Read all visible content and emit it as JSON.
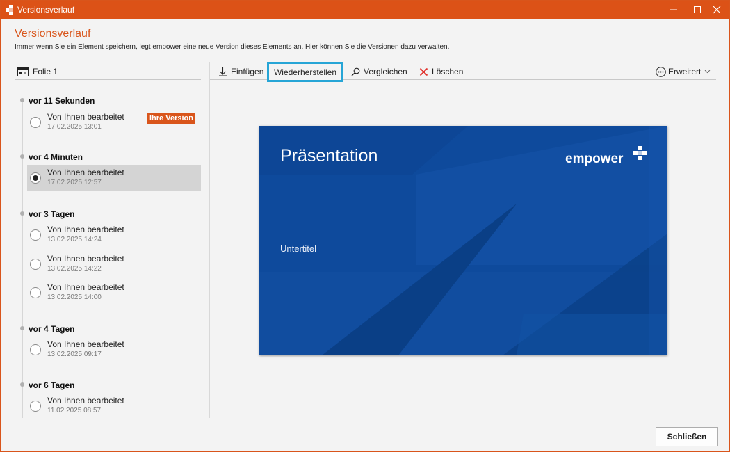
{
  "window": {
    "title": "Versionsverlauf",
    "accent_color": "#dc5217"
  },
  "header": {
    "title": "Versionsverlauf",
    "subtitle": "Immer wenn Sie ein Element speichern, legt empower eine neue Version dieses Elements an. Hier können Sie die Versionen dazu verwalten."
  },
  "left_panel": {
    "element_label": "Folie 1",
    "element_icon": "slide-icon"
  },
  "toolbar": {
    "insert_label": "Einfügen",
    "restore_label": "Wiederherstellen",
    "compare_label": "Vergleichen",
    "delete_label": "Löschen",
    "more_label": "Erweitert",
    "highlight_color": "#26a5d6"
  },
  "history": [
    {
      "label": "vor 11 Sekunden",
      "items": [
        {
          "who": "Von Ihnen bearbeitet",
          "when": "17.02.2025 13:01",
          "badge": "Ihre Version",
          "selected": false
        }
      ]
    },
    {
      "label": "vor 4 Minuten",
      "items": [
        {
          "who": "Von Ihnen bearbeitet",
          "when": "17.02.2025 12:57",
          "selected": true
        }
      ]
    },
    {
      "label": "vor 3 Tagen",
      "items": [
        {
          "who": "Von Ihnen bearbeitet",
          "when": "13.02.2025 14:24",
          "selected": false
        },
        {
          "who": "Von Ihnen bearbeitet",
          "when": "13.02.2025 14:22",
          "selected": false
        },
        {
          "who": "Von Ihnen bearbeitet",
          "when": "13.02.2025 14:00",
          "selected": false
        }
      ]
    },
    {
      "label": "vor 4 Tagen",
      "items": [
        {
          "who": "Von Ihnen bearbeitet",
          "when": "13.02.2025 09:17",
          "selected": false
        }
      ]
    },
    {
      "label": "vor 6 Tagen",
      "items": [
        {
          "who": "Von Ihnen bearbeitet",
          "when": "11.02.2025 08:57",
          "selected": false
        }
      ]
    }
  ],
  "preview": {
    "title": "Präsentation",
    "subtitle": "Untertitel",
    "logo_text": "empower",
    "background_color": "#0e4a9c"
  },
  "footer": {
    "close_label": "Schließen"
  }
}
